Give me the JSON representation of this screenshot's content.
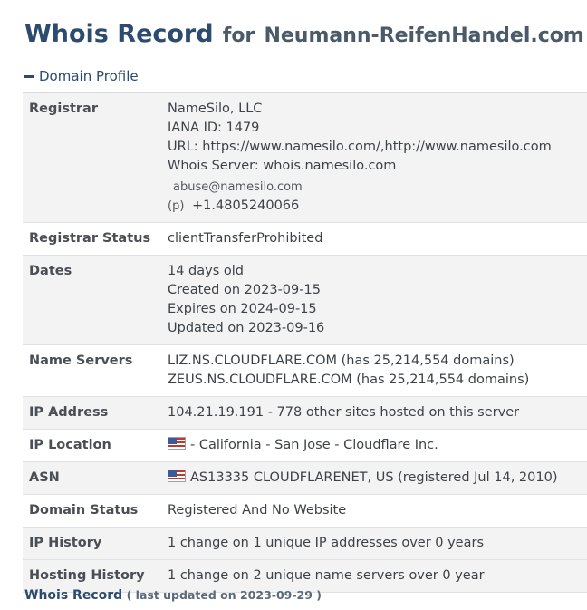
{
  "header": {
    "title_main": "Whois Record",
    "title_for": "for",
    "domain": "Neumann-ReifenHandel.com"
  },
  "section": {
    "label": "Domain Profile",
    "toggle_icon": "minus-icon"
  },
  "registrar": {
    "label": "Registrar",
    "name": "NameSilo, LLC",
    "iana": "IANA ID: 1479",
    "url": "URL: https://www.namesilo.com/,http://www.namesilo.com",
    "whois": "Whois Server: whois.namesilo.com",
    "email": "abuse@namesilo.com",
    "phone_prefix": "(p)",
    "phone": "+1.4805240066"
  },
  "registrar_status": {
    "label": "Registrar Status",
    "value": "clientTransferProhibited"
  },
  "dates": {
    "label": "Dates",
    "age": "14 days old",
    "created": "Created on 2023-09-15",
    "expires": "Expires on 2024-09-15",
    "updated": "Updated on 2023-09-16"
  },
  "name_servers": {
    "label": "Name Servers",
    "ns1": "LIZ.NS.CLOUDFLARE.COM (has 25,214,554 domains)",
    "ns2": "ZEUS.NS.CLOUDFLARE.COM (has 25,214,554 domains)"
  },
  "ip_address": {
    "label": "IP Address",
    "value": "104.21.19.191 - 778 other sites hosted on this server"
  },
  "ip_location": {
    "label": "IP Location",
    "value": "- California - San Jose - Cloudflare Inc.",
    "flag_icon": "us-flag-icon"
  },
  "asn": {
    "label": "ASN",
    "value": "AS13335 CLOUDFLARENET, US (registered Jul 14, 2010)",
    "flag_icon": "us-flag-icon"
  },
  "domain_status": {
    "label": "Domain Status",
    "value": "Registered And No Website"
  },
  "ip_history": {
    "label": "IP History",
    "value": "1 change on 1 unique IP addresses over 0 years"
  },
  "hosting_history": {
    "label": "Hosting History",
    "value": "1 change on 2 unique name servers over 0 year"
  },
  "footer": {
    "link": "Whois Record",
    "updated": "( last updated on 2023-09-29 )"
  },
  "colors": {
    "accent": "#2c4b6e",
    "row_shade": "#f3f3f3"
  }
}
